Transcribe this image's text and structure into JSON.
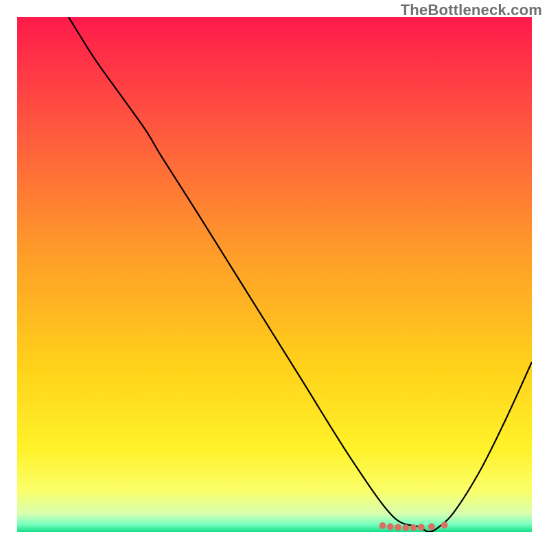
{
  "attribution": "TheBottleneck.com",
  "chart_data": {
    "type": "line",
    "title": "",
    "xlabel": "",
    "ylabel": "",
    "xlim": [
      0,
      100
    ],
    "ylim": [
      0,
      100
    ],
    "series": [
      {
        "name": "curve",
        "x": [
          10,
          15,
          20,
          25,
          28,
          35,
          45,
          55,
          65,
          73,
          78,
          80,
          82,
          85,
          90,
          95,
          100
        ],
        "y": [
          100,
          92,
          85,
          78,
          73,
          62,
          46,
          30,
          14,
          3,
          1,
          0,
          1,
          4,
          12,
          22,
          33
        ]
      }
    ],
    "markers": {
      "name": "dots",
      "x": [
        71,
        72.5,
        74,
        75.5,
        77,
        78.5,
        80.5,
        83
      ],
      "y": [
        1.2,
        1.0,
        0.9,
        0.8,
        0.8,
        0.9,
        1.0,
        1.3
      ],
      "color": "#d77164"
    },
    "gradient_stops": [
      {
        "offset": 0.0,
        "color": "#ff1a4b"
      },
      {
        "offset": 0.2,
        "color": "#ff5340"
      },
      {
        "offset": 0.45,
        "color": "#ff9a2a"
      },
      {
        "offset": 0.68,
        "color": "#ffd21a"
      },
      {
        "offset": 0.84,
        "color": "#fff22a"
      },
      {
        "offset": 0.92,
        "color": "#fbff6a"
      },
      {
        "offset": 0.965,
        "color": "#d8ffb0"
      },
      {
        "offset": 0.985,
        "color": "#7affc0"
      },
      {
        "offset": 1.0,
        "color": "#18e08a"
      }
    ]
  }
}
